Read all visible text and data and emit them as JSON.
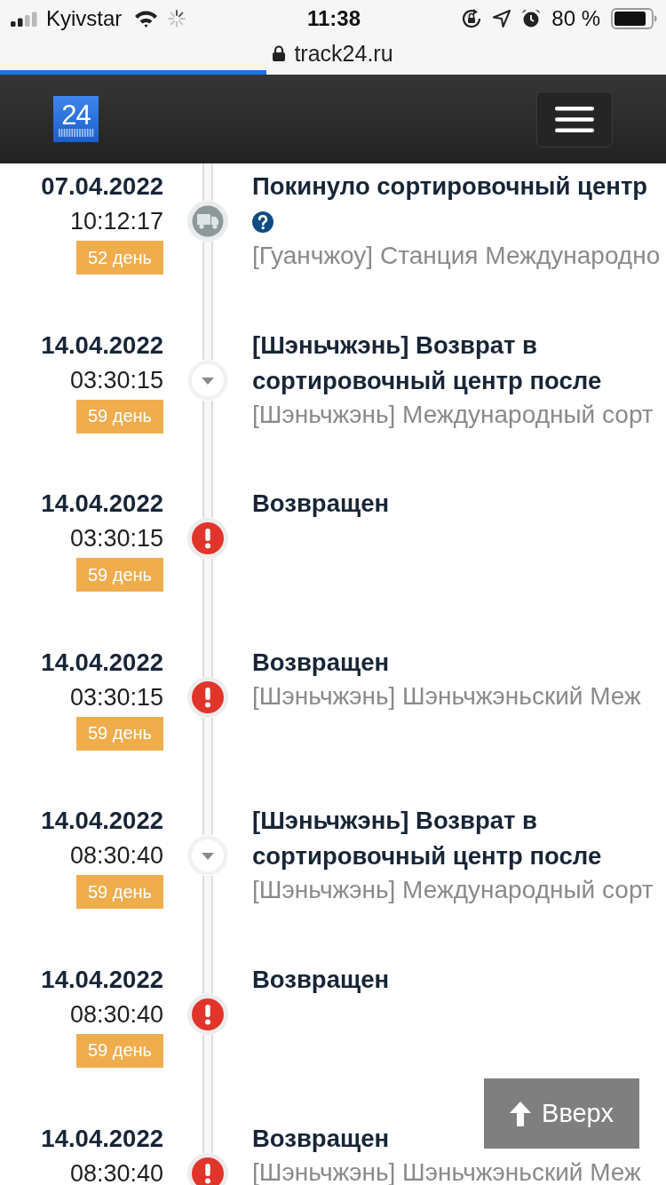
{
  "status_bar": {
    "carrier": "Kyivstar",
    "time": "11:38",
    "battery": "80 %"
  },
  "address_bar": {
    "url": "track24.ru",
    "progress": {
      "level": 0.4
    }
  },
  "header": {
    "logo": "24"
  },
  "events": [
    {
      "kind": "truck",
      "date": "07.04.2022",
      "time": "10:12:17",
      "days": "52 день",
      "title": "Покинуло сортировочный центр",
      "help": true,
      "description": "[Гуанчжоу] Станция Международно"
    },
    {
      "kind": "arrow",
      "date": "14.04.2022",
      "time": "03:30:15",
      "days": "59 день",
      "title": "[Шэньчжэнь] Возврат в сортировочный центр после",
      "help": false,
      "description": "[Шэньчжэнь] Международный сорт"
    },
    {
      "kind": "alert",
      "date": "14.04.2022",
      "time": "03:30:15",
      "days": "59 день",
      "title": "Возвращен",
      "help": false
    },
    {
      "kind": "alert",
      "date": "14.04.2022",
      "time": "03:30:15",
      "days": "59 день",
      "title": "Возвращен",
      "help": false,
      "description": "[Шэньчжэнь] Шэньчжэньский Меж"
    },
    {
      "kind": "arrow",
      "date": "14.04.2022",
      "time": "08:30:40",
      "days": "59 день",
      "title": "[Шэньчжэнь] Возврат в сортировочный центр после",
      "help": false,
      "description": "[Шэньчжэнь] Международный сорт"
    },
    {
      "kind": "alert",
      "date": "14.04.2022",
      "time": "08:30:40",
      "days": "59 день",
      "title": "Возвращен",
      "help": false
    },
    {
      "kind": "alert",
      "date": "14.04.2022",
      "time": "08:30:40",
      "title": "Возвращен",
      "help": false,
      "description": "[Шэньчжэнь] Шэньчжэньский Меж"
    }
  ],
  "back_to_top": {
    "label": "Вверх"
  }
}
